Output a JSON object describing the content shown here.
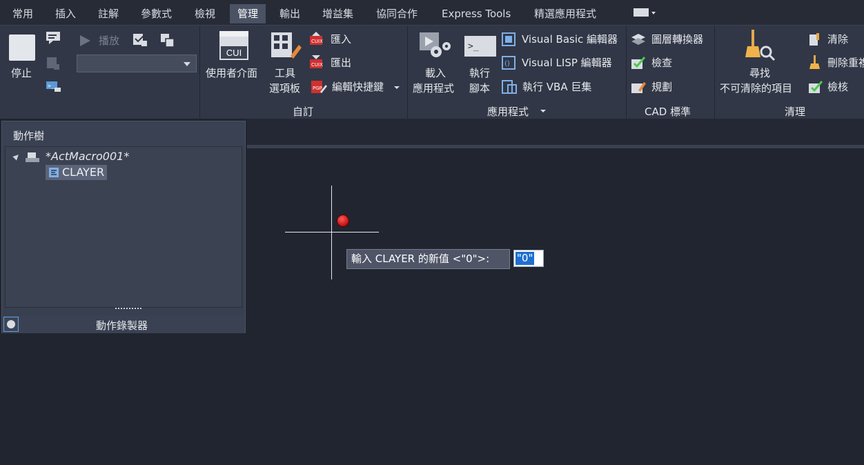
{
  "tabs": [
    "常用",
    "插入",
    "註解",
    "參數式",
    "檢視",
    "管理",
    "輸出",
    "增益集",
    "協同合作",
    "Express Tools",
    "精選應用程式"
  ],
  "active_tab": "管理",
  "ribbon": {
    "recorder": {
      "stop": "停止",
      "play": "播放"
    },
    "customize": {
      "cui_badge": "CUI",
      "user_interface": "使用者介面",
      "tool_palettes_1": "工具",
      "tool_palettes_2": "選項板",
      "import": "匯入",
      "export": "匯出",
      "edit_aliases": "編輯快捷鍵",
      "title": "自訂"
    },
    "applications": {
      "load_1": "載入",
      "load_2": "應用程式",
      "run_1": "執行",
      "run_2": "腳本",
      "vb_editor": "Visual Basic 編輯器",
      "lisp_editor": "Visual LISP 編輯器",
      "run_vba": "執行 VBA 巨集",
      "title": "應用程式"
    },
    "cad_standards": {
      "layer_translator": "圖層轉換器",
      "check": "檢查",
      "configure": "規劃",
      "title": "CAD 標準"
    },
    "cleanup": {
      "find_1": "尋找",
      "find_2": "不可清除的項目",
      "purge": "清除",
      "overkill": "刪除重複",
      "audit": "檢核",
      "title": "清理"
    }
  },
  "action_tree": {
    "title": "動作樹",
    "macro": "*ActMacro001*",
    "child": "CLAYER",
    "footer": "動作錄製器"
  },
  "command": {
    "prompt": "輸入 CLAYER 的新值 <\"0\">:",
    "value": "\"0\""
  },
  "colors": {
    "background": "#212530",
    "ribbon": "#313746",
    "active_tab": "#4a5264",
    "selection": "#1e6fd0"
  }
}
